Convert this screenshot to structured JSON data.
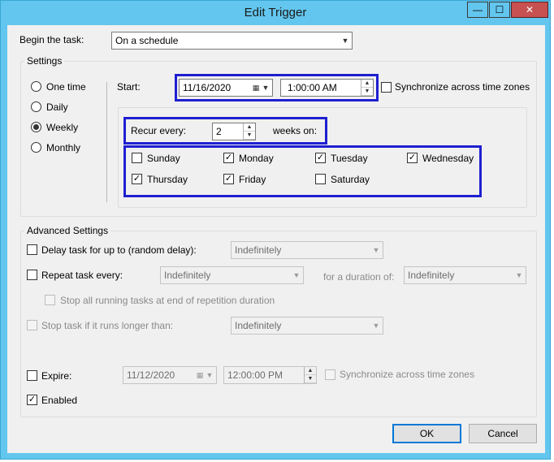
{
  "window": {
    "title": "Edit Trigger",
    "minimize_glyph": "—",
    "maximize_glyph": "☐",
    "close_glyph": "✕"
  },
  "begin": {
    "label": "Begin the task:",
    "value": "On a schedule"
  },
  "settings": {
    "group_label": "Settings",
    "schedule_options": [
      {
        "label": "One time",
        "checked": false
      },
      {
        "label": "Daily",
        "checked": false
      },
      {
        "label": "Weekly",
        "checked": true
      },
      {
        "label": "Monthly",
        "checked": false
      }
    ],
    "start_label": "Start:",
    "start_date": "11/16/2020",
    "start_time": "1:00:00 AM",
    "sync_label": "Synchronize across time zones",
    "sync_checked": false,
    "recur_label": "Recur every:",
    "recur_value": "2",
    "weeks_on_label": "weeks on:",
    "days": [
      {
        "label": "Sunday",
        "checked": false
      },
      {
        "label": "Monday",
        "checked": true
      },
      {
        "label": "Tuesday",
        "checked": true
      },
      {
        "label": "Wednesday",
        "checked": true
      },
      {
        "label": "Thursday",
        "checked": true
      },
      {
        "label": "Friday",
        "checked": true
      },
      {
        "label": "Saturday",
        "checked": false
      }
    ]
  },
  "advanced": {
    "group_label": "Advanced Settings",
    "delay_label": "Delay task for up to (random delay):",
    "delay_value": "Indefinitely",
    "repeat_label": "Repeat task every:",
    "repeat_value": "Indefinitely",
    "duration_label": "for a duration of:",
    "duration_value": "Indefinitely",
    "stop_running_label": "Stop all running tasks at end of repetition duration",
    "stop_longer_label": "Stop task if it runs longer than:",
    "stop_longer_value": "Indefinitely",
    "expire_label": "Expire:",
    "expire_date": "11/12/2020",
    "expire_time": "12:00:00 PM",
    "expire_sync_label": "Synchronize across time zones",
    "enabled_label": "Enabled",
    "enabled_checked": true
  },
  "buttons": {
    "ok": "OK",
    "cancel": "Cancel"
  },
  "glyphs": {
    "check": "✓",
    "dropdown": "▼",
    "spin_up": "▲",
    "spin_down": "▼",
    "calendar": "▦"
  },
  "colors": {
    "title_bar": "#63c6ee",
    "highlight_border": "#1f1fd1",
    "close_button": "#c75050"
  }
}
